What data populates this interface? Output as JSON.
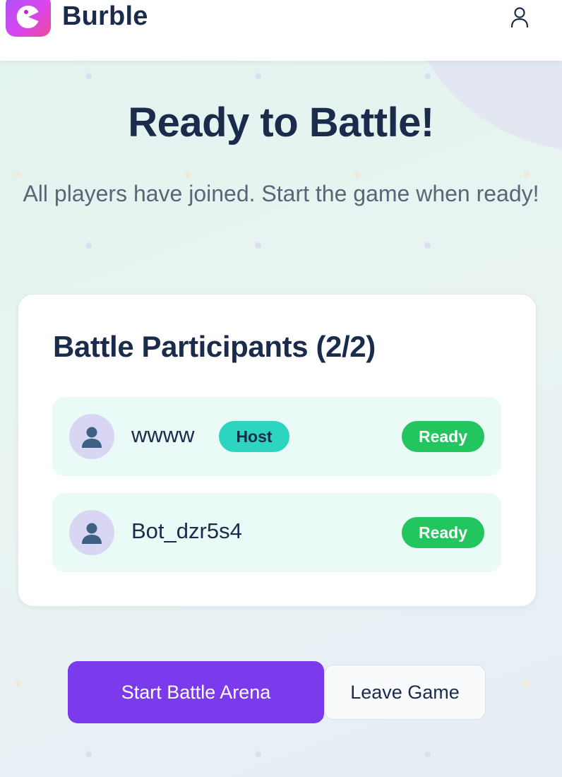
{
  "header": {
    "brand": "Burble",
    "logo_icon": "pacman-icon",
    "user_icon": "user-icon"
  },
  "main": {
    "title": "Ready to Battle!",
    "subtitle": "All players have joined. Start the game when ready!"
  },
  "participants": {
    "title": "Battle Participants (2/2)",
    "players": [
      {
        "name": "wwww",
        "badge": "Host",
        "status": "Ready"
      },
      {
        "name": "Bot_dzr5s4",
        "badge": "",
        "status": "Ready"
      }
    ]
  },
  "actions": {
    "start_label": "Start Battle Arena",
    "leave_label": "Leave Game"
  },
  "colors": {
    "primary": "#7c3aed",
    "host_badge": "#2dd4bf",
    "ready_badge": "#22c55e",
    "text_dark": "#1a2b4c",
    "logo_gradient_start": "#a855f7",
    "logo_gradient_end": "#ec4899"
  }
}
